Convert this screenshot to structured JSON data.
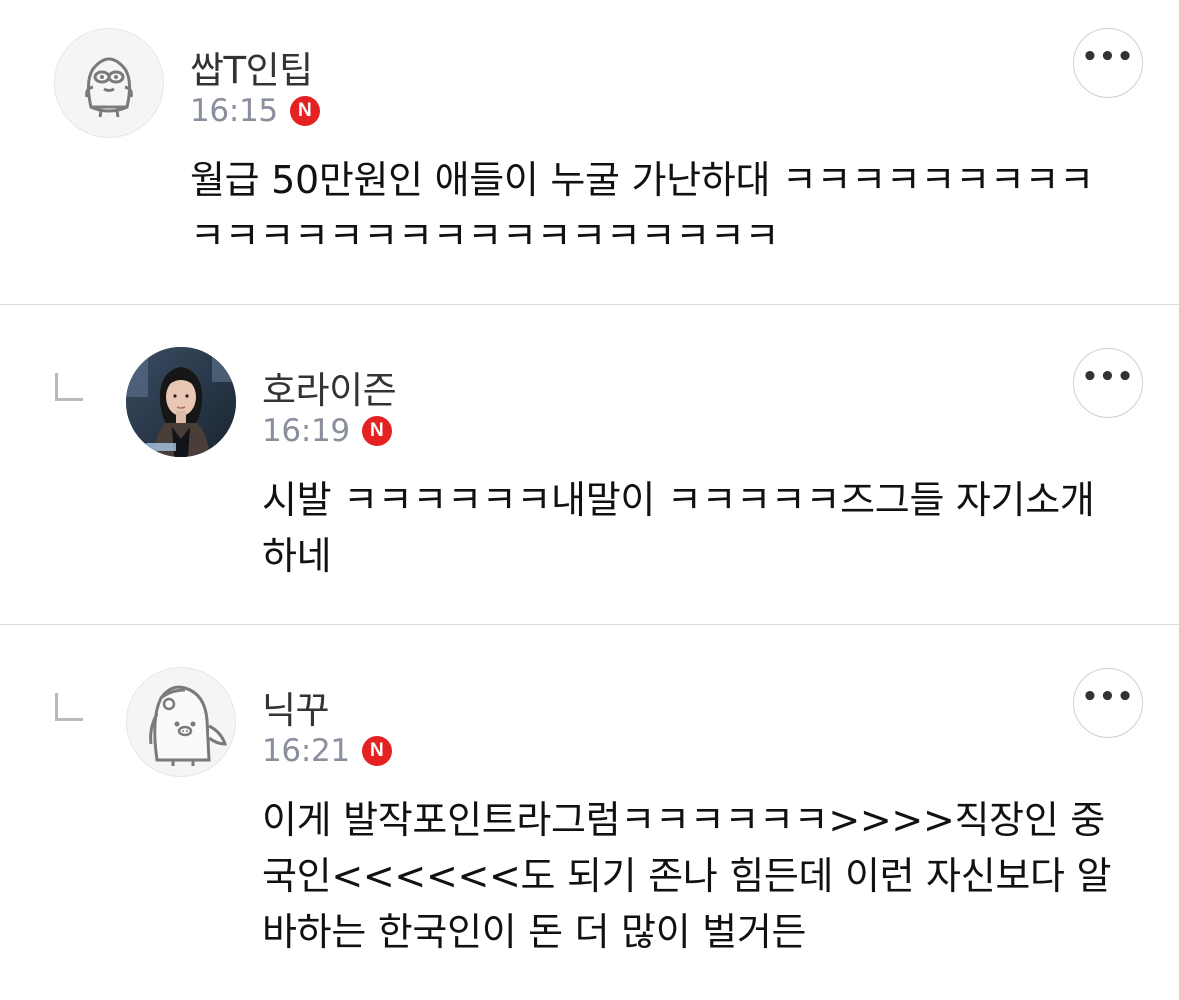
{
  "comments": [
    {
      "nickname": "쌉T인팁",
      "time": "16:15",
      "badge": "N",
      "is_reply": false,
      "avatar": "character-face-icon",
      "text": "월급 50만원인 애들이 누굴 가난하대 ㅋㅋㅋㅋㅋㅋㅋㅋㅋㅋㅋㅋㅋㅋㅋㅋㅋㅋㅋㅋㅋㅋㅋㅋㅋㅋ",
      "more_label": "•••"
    },
    {
      "nickname": "호라이즌",
      "time": "16:19",
      "badge": "N",
      "is_reply": true,
      "avatar": "profile-photo",
      "text": "시발 ㅋㅋㅋㅋㅋㅋ내말이 ㅋㅋㅋㅋㅋ즈그들 자기소개하네",
      "more_label": "•••"
    },
    {
      "nickname": "닉꾸",
      "time": "16:21",
      "badge": "N",
      "is_reply": true,
      "avatar": "character-bird-icon",
      "text": "이게 발작포인트라그럼ㅋㅋㅋㅋㅋㅋ>>>>직장인 중국인<<<<<<도 되기 존나 힘든데 이런 자신보다 알바하는 한국인이 돈 더 많이 벌거든",
      "more_label": "•••"
    }
  ],
  "colors": {
    "time": "#8a8f9e",
    "badge": "#e52222",
    "divider": "#dcdcdc"
  }
}
